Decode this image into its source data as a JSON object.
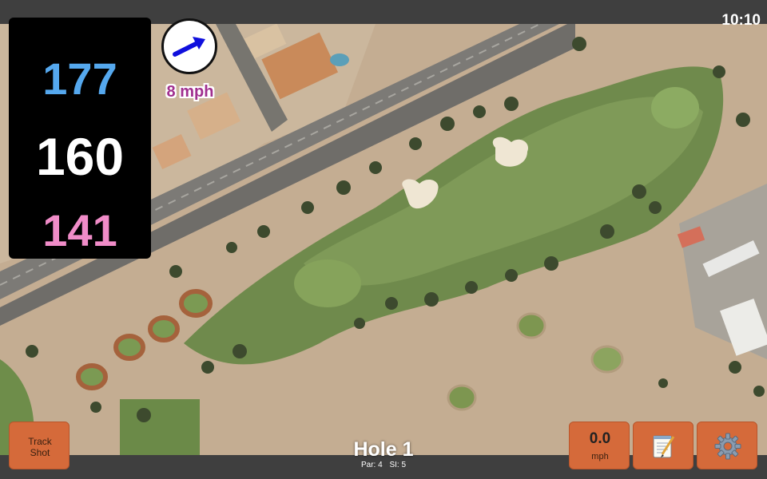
{
  "status": {
    "time": "10:10"
  },
  "yardage": {
    "back": "177",
    "center": "160",
    "front": "141"
  },
  "wind": {
    "speed_label": "8 mph",
    "direction_icon": "wind-arrow-icon"
  },
  "hole": {
    "title": "Hole 1",
    "par": "Par: 4",
    "stroke_index": "SI: 5"
  },
  "buttons": {
    "track_shot_line1": "Track",
    "track_shot_line2": "Shot",
    "speed_value": "0.0",
    "speed_unit": "mph",
    "notes_icon": "notepad-icon",
    "settings_icon": "gear-icon"
  },
  "colors": {
    "back_yardage": "#55a8ee",
    "center_yardage": "#ffffff",
    "front_yardage": "#f08cc8",
    "button_bg": "#d56a3a",
    "wind_label": "#a02f8f"
  }
}
